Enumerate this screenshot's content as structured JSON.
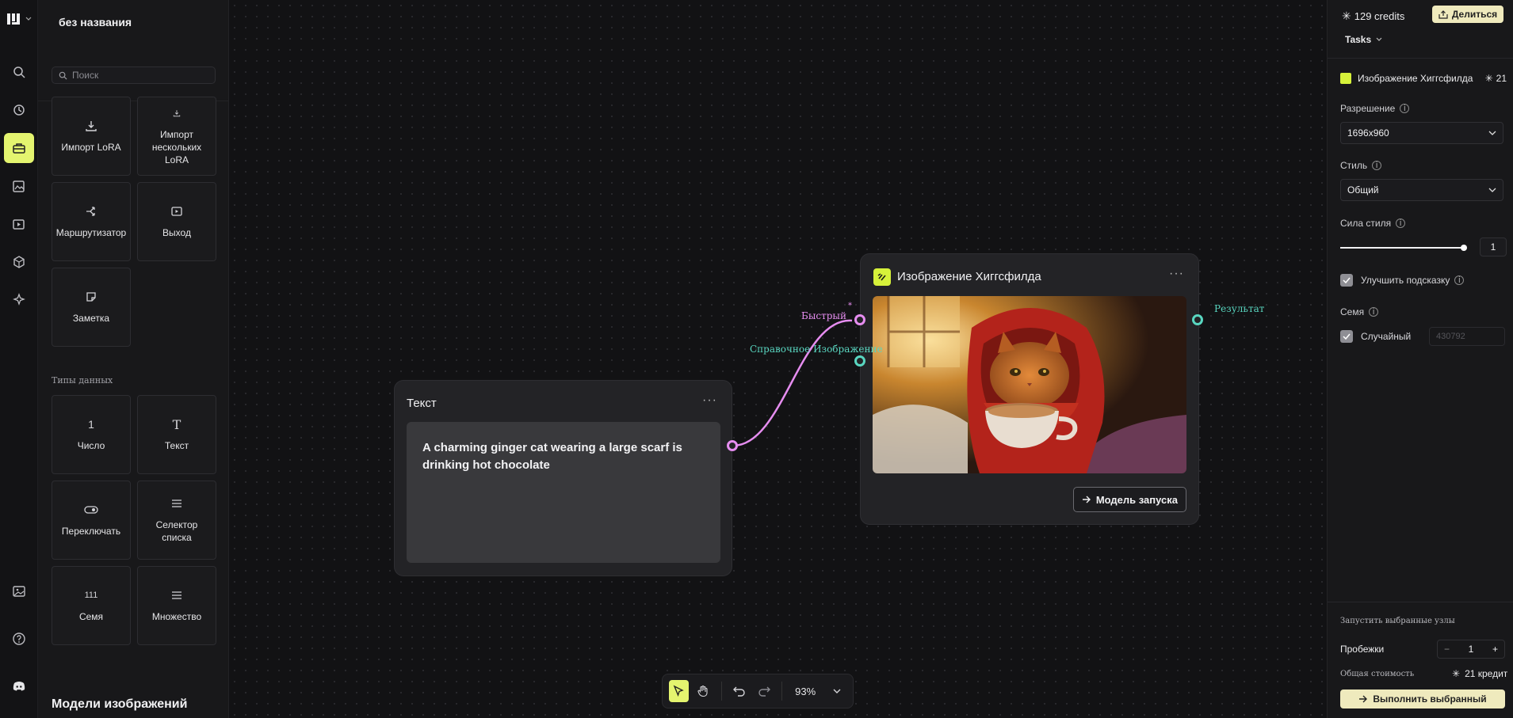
{
  "app": {
    "project_title": "без названия"
  },
  "library": {
    "search_placeholder": "Поиск",
    "tiles_top": [
      {
        "label": "Импорт LoRA",
        "icon": "download-icon"
      },
      {
        "label": "Импорт нескольких LoRA",
        "icon": "download-small-icon"
      },
      {
        "label": "Маршрутизатор",
        "icon": "router-icon"
      },
      {
        "label": "Выход",
        "icon": "output-icon"
      },
      {
        "label": "Заметка",
        "icon": "note-icon"
      }
    ],
    "data_types_label": "Типы данных",
    "data_types": [
      {
        "label": "Число",
        "icon_text": "1"
      },
      {
        "label": "Текст",
        "icon_text": "T"
      },
      {
        "label": "Переключать",
        "icon": "toggle-icon"
      },
      {
        "label": "Селектор списка",
        "icon": "list-icon"
      },
      {
        "label": "Семя",
        "icon_text": "111"
      },
      {
        "label": "Множество",
        "icon": "list-icon"
      }
    ],
    "image_models_heading": "Модели изображений"
  },
  "canvas": {
    "text_node": {
      "title": "Текст",
      "more": "···",
      "content": "A charming ginger cat wearing a large scarf is drinking hot chocolate"
    },
    "image_node": {
      "title": "Изображение Хиггсфилда",
      "more": "···",
      "input_prompt_label": "Быстрый",
      "input_prompt_required": "*",
      "input_image_label": "Справочное Изображение",
      "output_label": "Результат",
      "run_button": "Модель запуска"
    },
    "toolbar": {
      "zoom": "93%"
    },
    "colors": {
      "accent": "#e4f46f",
      "prompt_port": "#e68df0",
      "image_port": "#59d6c0"
    }
  },
  "right_panel": {
    "credits": "129 credits",
    "share_button": "Делиться",
    "tasks": "Tasks",
    "model_name": "Изображение Хиггсфилда",
    "model_cost": "21",
    "resolution_label": "Разрешение",
    "resolution_value": "1696x960",
    "style_label": "Стиль",
    "style_value": "Общий",
    "style_strength_label": "Сила стиля",
    "style_strength_value": "1",
    "style_strength_fraction": 1.0,
    "enhance_prompt_label": "Улучшить подсказку",
    "enhance_prompt_checked": true,
    "seed_label": "Семя",
    "seed_random_label": "Случайный",
    "seed_random_checked": true,
    "seed_placeholder": "430792",
    "run_selected_label": "Запустить выбранные узлы",
    "runs_label": "Пробежки",
    "runs_value": "1",
    "runs_minus": "−",
    "runs_plus": "+",
    "total_cost_label": "Общая стоимость",
    "total_cost_value": "21 кредит",
    "execute_button": "Выполнить выбранный"
  }
}
